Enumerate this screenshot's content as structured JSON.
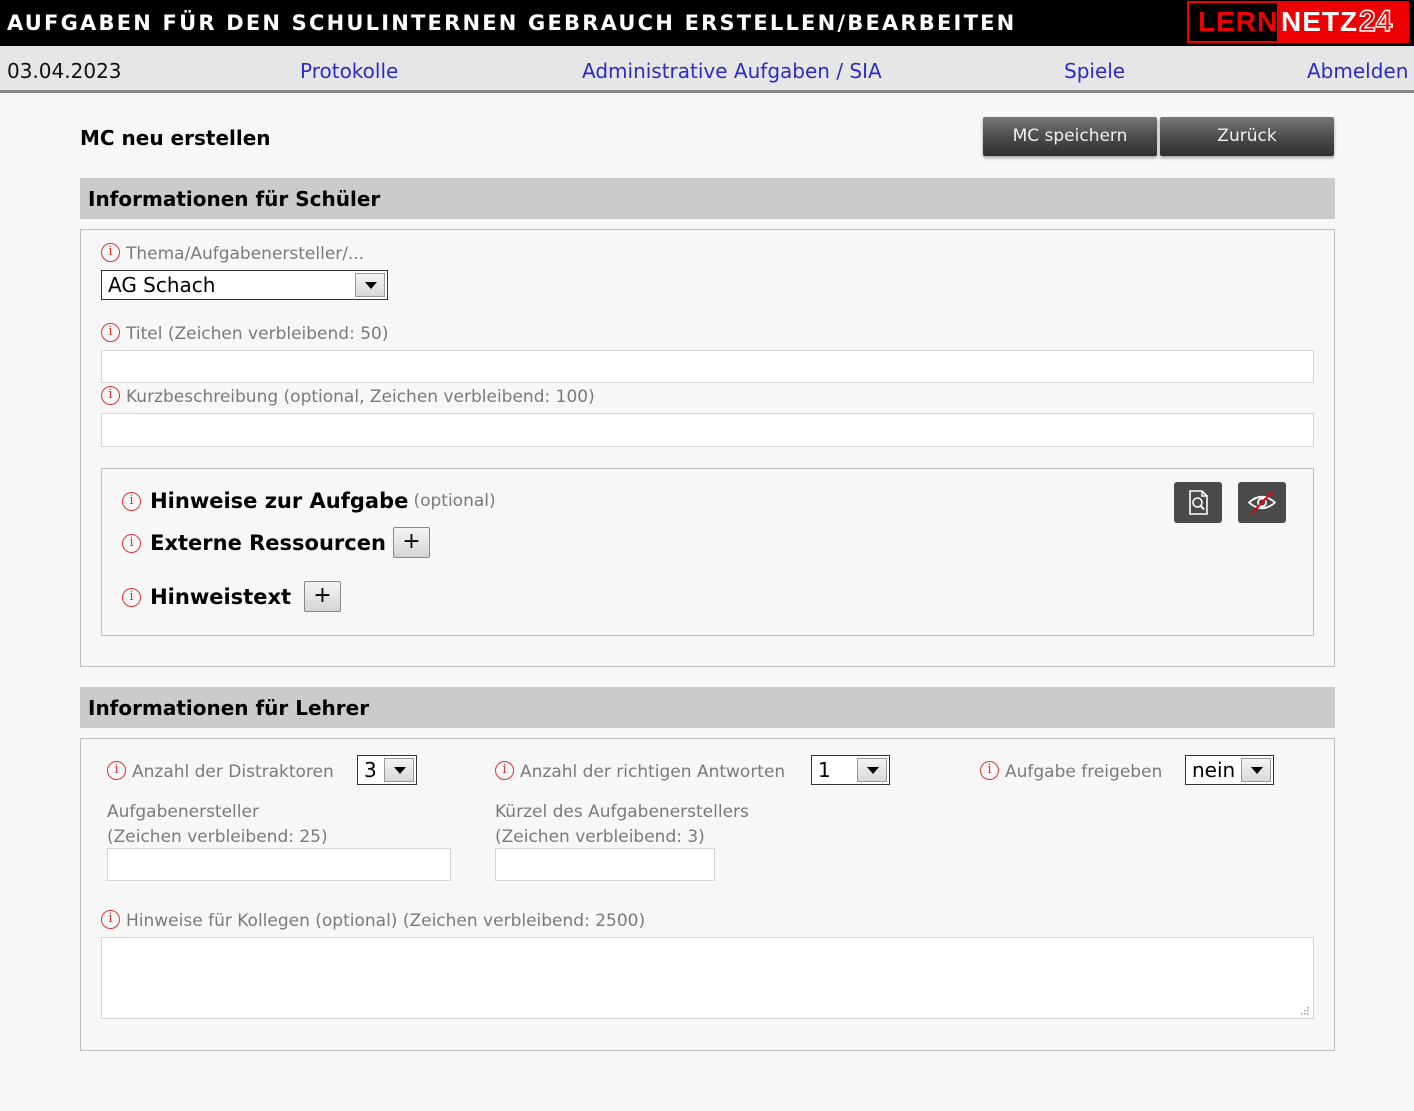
{
  "header": {
    "title": "AUFGABEN FÜR DEN SCHULINTERNEN GEBRAUCH ERSTELLEN/BEARBEITEN",
    "logo": {
      "part1": "LERN",
      "part2": "NETZ",
      "part3": "24"
    }
  },
  "nav": {
    "date": "03.04.2023",
    "links": [
      "Protokolle",
      "Administrative Aufgaben / SIA",
      "Spiele",
      "Abmelden"
    ]
  },
  "page": {
    "title": "MC neu erstellen",
    "save_button": "MC speichern",
    "back_button": "Zurück"
  },
  "students": {
    "heading": "Informationen für Schüler",
    "topic_label": "Thema/Aufgabenersteller/...",
    "topic_value": "AG Schach",
    "title_label": "Titel (Zeichen verbleibend: 50)",
    "title_value": "",
    "short_label": "Kurzbeschreibung (optional, Zeichen verbleibend: 100)",
    "short_value": "",
    "hints_heading": "Hinweise zur Aufgabe",
    "hints_optional": "(optional)",
    "external_resources": "Externe Ressourcen",
    "hint_text": "Hinweistext",
    "plus": "+"
  },
  "teachers": {
    "heading": "Informationen für Lehrer",
    "distractors_label": "Anzahl der Distraktoren",
    "distractors_value": "3",
    "correct_label": "Anzahl der richtigen Antworten",
    "correct_value": "1",
    "release_label": "Aufgabe freigeben",
    "release_value": "nein",
    "author_label_1": "Aufgabenersteller",
    "author_label_2": "(Zeichen verbleibend: 25)",
    "abbr_label_1": "Kürzel des Aufgabenerstellers",
    "abbr_label_2": "(Zeichen verbleibend: 3)",
    "colleagues_label": "Hinweise für Kollegen (optional) (Zeichen verbleibend: 2500)"
  },
  "icons": {
    "info": "info-icon",
    "preview": "document-search-icon",
    "visibility": "eye-crossed-icon"
  },
  "colors": {
    "accent": "#ee0000",
    "link": "#2b2bc9",
    "section_header": "#cbcbcb",
    "button_dark": "#4d4d4d"
  }
}
